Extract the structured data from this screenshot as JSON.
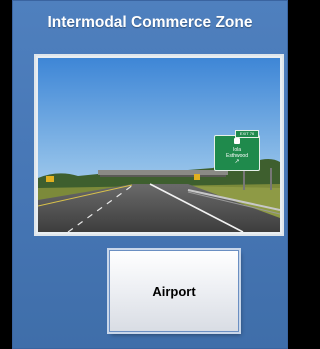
{
  "slide": {
    "title": "Intermodal Commerce Zone",
    "button_label": "Airport"
  },
  "photo": {
    "sign_exit": "EXIT 76",
    "sign_line1": "Iola",
    "sign_line2": "Esthwood"
  },
  "colors": {
    "panel": "#4a79b8",
    "sign_green": "#1f8a4c"
  }
}
